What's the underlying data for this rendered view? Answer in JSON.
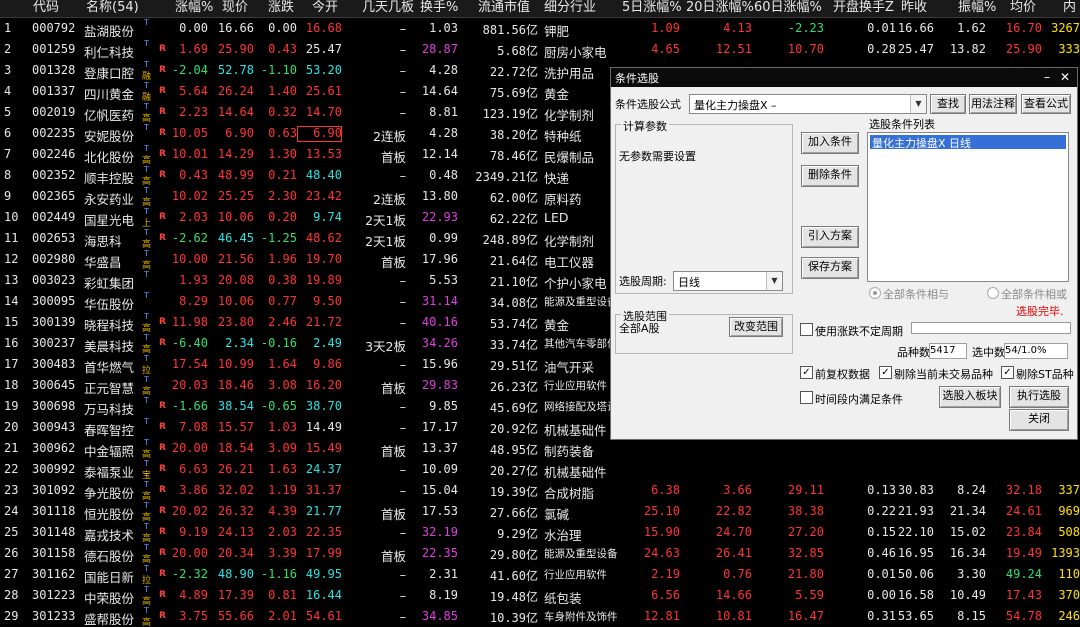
{
  "headers": [
    "代码",
    "名称(54)",
    "涨幅%",
    "现价",
    "涨跌",
    "今开",
    "几天几板",
    "换手%",
    "流通市值",
    "细分行业",
    "5日涨幅%",
    "20日涨幅%",
    "60日涨幅%",
    "开盘换手Z",
    "昨收",
    "振幅%",
    "均价",
    "内"
  ],
  "rows": [
    {
      "n": "1",
      "code": "000792",
      "name": "盐湖股份",
      "mk": "T",
      "flag": "",
      "chg": "0.00",
      "price": "16.66",
      "diff": "0.00",
      "open": "16.68",
      "consec": "–",
      "turn": "1.03",
      "cap": "881.56亿",
      "ind": "钾肥",
      "d5": "1.09",
      "d20": "4.13",
      "d60": "-2.23",
      "oturn": "0.01",
      "prev": "16.66",
      "amp": "1.62",
      "avg": "16.70",
      "inn": "3267",
      "tc": {
        "chg": "wht",
        "price": "wht",
        "diff": "wht",
        "open": "red",
        "d5": "red",
        "d20": "red",
        "d60": "grn",
        "avg": "red",
        "turn": "wht"
      }
    },
    {
      "n": "2",
      "code": "001259",
      "name": "利仁科技",
      "mk": "T",
      "flag": "R",
      "chg": "1.69",
      "price": "25.90",
      "diff": "0.43",
      "open": "25.47",
      "consec": "–",
      "turn": "28.87",
      "cap": "5.68亿",
      "ind": "厨房小家电",
      "d5": "4.65",
      "d20": "12.51",
      "d60": "10.70",
      "oturn": "0.28",
      "prev": "25.47",
      "amp": "13.82",
      "avg": "25.90",
      "inn": "333",
      "tc": {
        "chg": "red",
        "price": "red",
        "diff": "red",
        "open": "wht",
        "d5": "red",
        "d20": "red",
        "d60": "red",
        "avg": "red",
        "turn": "mag"
      }
    },
    {
      "n": "3",
      "code": "001328",
      "name": "登康口腔",
      "mk": "T",
      "mk2": "融",
      "flag": "R",
      "chg": "-2.04",
      "price": "52.78",
      "diff": "-1.10",
      "open": "53.20",
      "consec": "–",
      "turn": "4.28",
      "cap": "22.72亿",
      "ind": "洗护用品",
      "d5": "",
      "d20": "",
      "d60": "",
      "oturn": "",
      "prev": "",
      "amp": "",
      "avg": "",
      "inn": "",
      "tc": {
        "chg": "grn",
        "price": "cyan",
        "diff": "grn",
        "open": "cyan",
        "turn": "wht"
      }
    },
    {
      "n": "4",
      "code": "001337",
      "name": "四川黄金",
      "mk": "T",
      "mk2": "融",
      "flag": "R",
      "chg": "5.64",
      "price": "26.24",
      "diff": "1.40",
      "open": "25.61",
      "consec": "–",
      "turn": "14.64",
      "cap": "75.69亿",
      "ind": "黄金",
      "d5": "",
      "d20": "",
      "d60": "",
      "oturn": "",
      "prev": "",
      "amp": "",
      "avg": "",
      "inn": "",
      "tc": {
        "chg": "red",
        "price": "red",
        "diff": "red",
        "open": "red",
        "turn": "wht"
      }
    },
    {
      "n": "5",
      "code": "002019",
      "name": "亿帆医药",
      "mk": "T",
      "mk2": "高",
      "flag": "R",
      "chg": "2.23",
      "price": "14.64",
      "diff": "0.32",
      "open": "14.70",
      "consec": "–",
      "turn": "8.81",
      "cap": "123.19亿",
      "ind": "化学制剂",
      "d5": "",
      "d20": "",
      "d60": "",
      "oturn": "",
      "prev": "",
      "amp": "",
      "avg": "",
      "inn": "",
      "tc": {
        "chg": "red",
        "price": "red",
        "diff": "red",
        "open": "red",
        "turn": "wht"
      }
    },
    {
      "n": "6",
      "code": "002235",
      "name": "安妮股份",
      "mk": "T",
      "flag": "R",
      "chg": "10.05",
      "price": "6.90",
      "diff": "0.63",
      "open": "6.90",
      "consec": "2连板",
      "turn": "4.28",
      "cap": "38.20亿",
      "ind": "特种纸",
      "d5": "",
      "d20": "",
      "d60": "",
      "oturn": "",
      "prev": "",
      "amp": "",
      "avg": "",
      "inn": "",
      "box": true,
      "tc": {
        "chg": "red",
        "price": "red",
        "diff": "red",
        "open": "red",
        "turn": "wht"
      }
    },
    {
      "n": "7",
      "code": "002246",
      "name": "北化股份",
      "mk": "T",
      "mk2": "高",
      "flag": "R",
      "chg": "10.01",
      "price": "14.29",
      "diff": "1.30",
      "open": "13.53",
      "consec": "首板",
      "turn": "12.14",
      "cap": "78.46亿",
      "ind": "民爆制品",
      "d5": "",
      "d20": "",
      "d60": "",
      "oturn": "",
      "prev": "",
      "amp": "",
      "avg": "",
      "inn": "",
      "tc": {
        "chg": "red",
        "price": "red",
        "diff": "red",
        "open": "red",
        "turn": "wht"
      }
    },
    {
      "n": "8",
      "code": "002352",
      "name": "顺丰控股",
      "mk": "T",
      "mk2": "高",
      "flag": "R",
      "chg": "0.43",
      "price": "48.99",
      "diff": "0.21",
      "open": "48.40",
      "consec": "–",
      "turn": "0.48",
      "cap": "2349.21亿",
      "ind": "快递",
      "d5": "",
      "d20": "",
      "d60": "",
      "oturn": "",
      "prev": "",
      "amp": "",
      "avg": "",
      "inn": "",
      "tc": {
        "chg": "red",
        "price": "red",
        "diff": "red",
        "open": "cyan",
        "turn": "wht"
      }
    },
    {
      "n": "9",
      "code": "002365",
      "name": "永安药业",
      "mk": "T",
      "mk2": "高",
      "flag": "",
      "chg": "10.02",
      "price": "25.25",
      "diff": "2.30",
      "open": "23.42",
      "consec": "2连板",
      "turn": "13.80",
      "cap": "62.00亿",
      "ind": "原料药",
      "d5": "",
      "d20": "",
      "d60": "",
      "oturn": "",
      "prev": "",
      "amp": "",
      "avg": "",
      "inn": "",
      "tc": {
        "chg": "red",
        "price": "red",
        "diff": "red",
        "open": "red",
        "turn": "wht"
      }
    },
    {
      "n": "10",
      "code": "002449",
      "name": "国星光电",
      "mk": "T",
      "mk2": "上",
      "flag": "R",
      "chg": "2.03",
      "price": "10.06",
      "diff": "0.20",
      "open": "9.74",
      "consec": "2天1板",
      "turn": "22.93",
      "cap": "62.22亿",
      "ind": "LED",
      "d5": "",
      "d20": "",
      "d60": "",
      "oturn": "",
      "prev": "",
      "amp": "",
      "avg": "",
      "inn": "",
      "tc": {
        "chg": "red",
        "price": "red",
        "diff": "red",
        "open": "cyan",
        "turn": "mag"
      }
    },
    {
      "n": "11",
      "code": "002653",
      "name": "海思科",
      "mk": "T",
      "mk2": "高",
      "flag": "R",
      "chg": "-2.62",
      "price": "46.45",
      "diff": "-1.25",
      "open": "48.62",
      "consec": "2天1板",
      "turn": "0.99",
      "cap": "248.89亿",
      "ind": "化学制剂",
      "d5": "",
      "d20": "",
      "d60": "",
      "oturn": "",
      "prev": "",
      "amp": "",
      "avg": "",
      "inn": "",
      "tc": {
        "chg": "grn",
        "price": "cyan",
        "diff": "grn",
        "open": "red",
        "turn": "wht"
      }
    },
    {
      "n": "12",
      "code": "002980",
      "name": "华盛昌",
      "mk": "T",
      "mk2": "高",
      "flag": "",
      "chg": "10.00",
      "price": "21.56",
      "diff": "1.96",
      "open": "19.70",
      "consec": "首板",
      "turn": "17.96",
      "cap": "21.64亿",
      "ind": "电工仪器",
      "d5": "",
      "d20": "",
      "d60": "",
      "oturn": "",
      "prev": "",
      "amp": "",
      "avg": "",
      "inn": "",
      "tc": {
        "chg": "red",
        "price": "red",
        "diff": "red",
        "open": "red",
        "turn": "wht"
      }
    },
    {
      "n": "13",
      "code": "003023",
      "name": "彩虹集团",
      "mk": "T",
      "flag": "",
      "chg": "1.93",
      "price": "20.08",
      "diff": "0.38",
      "open": "19.89",
      "consec": "–",
      "turn": "5.53",
      "cap": "21.10亿",
      "ind": "个护小家电",
      "d5": "",
      "d20": "",
      "d60": "",
      "oturn": "",
      "prev": "",
      "amp": "",
      "avg": "",
      "inn": "",
      "tc": {
        "chg": "red",
        "price": "red",
        "diff": "red",
        "open": "red",
        "turn": "wht"
      }
    },
    {
      "n": "14",
      "code": "300095",
      "name": "华伍股份",
      "mk": "T",
      "flag": "",
      "chg": "8.29",
      "price": "10.06",
      "diff": "0.77",
      "open": "9.50",
      "consec": "–",
      "turn": "31.14",
      "cap": "34.08亿",
      "ind": "能源及重型设备",
      "sm": true,
      "d5": "",
      "d20": "",
      "d60": "",
      "oturn": "",
      "prev": "",
      "amp": "",
      "avg": "",
      "inn": "",
      "tc": {
        "chg": "red",
        "price": "red",
        "diff": "red",
        "open": "red",
        "turn": "mag"
      }
    },
    {
      "n": "15",
      "code": "300139",
      "name": "晓程科技",
      "mk": "T",
      "mk2": "高",
      "flag": "R",
      "chg": "11.98",
      "price": "23.80",
      "diff": "2.46",
      "open": "21.72",
      "consec": "–",
      "turn": "40.16",
      "cap": "53.74亿",
      "ind": "黄金",
      "d5": "",
      "d20": "",
      "d60": "",
      "oturn": "",
      "prev": "",
      "amp": "",
      "avg": "",
      "inn": "",
      "tc": {
        "chg": "red",
        "price": "red",
        "diff": "red",
        "open": "red",
        "turn": "mag"
      }
    },
    {
      "n": "16",
      "code": "300237",
      "name": "美晨科技",
      "mk": "T",
      "mk2": "高",
      "flag": "R",
      "chg": "-6.40",
      "price": "2.34",
      "diff": "-0.16",
      "open": "2.49",
      "consec": "3天2板",
      "turn": "34.26",
      "cap": "33.74亿",
      "ind": "其他汽车零部件",
      "sm": true,
      "d5": "",
      "d20": "",
      "d60": "",
      "oturn": "",
      "prev": "",
      "amp": "",
      "avg": "",
      "inn": "",
      "tc": {
        "chg": "grn",
        "price": "cyan",
        "diff": "grn",
        "open": "cyan",
        "turn": "mag"
      }
    },
    {
      "n": "17",
      "code": "300483",
      "name": "首华燃气",
      "mk": "T",
      "mk2": "拉",
      "flag": "",
      "chg": "17.54",
      "price": "10.99",
      "diff": "1.64",
      "open": "9.86",
      "consec": "–",
      "turn": "15.96",
      "cap": "29.51亿",
      "ind": "油气开采",
      "d5": "",
      "d20": "",
      "d60": "",
      "oturn": "",
      "prev": "",
      "amp": "",
      "avg": "",
      "inn": "",
      "tc": {
        "chg": "red",
        "price": "red",
        "diff": "red",
        "open": "red",
        "turn": "wht"
      }
    },
    {
      "n": "18",
      "code": "300645",
      "name": "正元智慧",
      "mk": "T",
      "mk2": "高",
      "flag": "",
      "chg": "20.03",
      "price": "18.46",
      "diff": "3.08",
      "open": "16.20",
      "consec": "首板",
      "turn": "29.83",
      "cap": "26.23亿",
      "ind": "行业应用软件",
      "sm": true,
      "d5": "",
      "d20": "",
      "d60": "",
      "oturn": "",
      "prev": "",
      "amp": "",
      "avg": "",
      "inn": "",
      "tc": {
        "chg": "red",
        "price": "red",
        "diff": "red",
        "open": "red",
        "turn": "mag"
      }
    },
    {
      "n": "19",
      "code": "300698",
      "name": "万马科技",
      "mk": "T",
      "flag": "R",
      "chg": "-1.66",
      "price": "38.54",
      "diff": "-0.65",
      "open": "38.70",
      "consec": "–",
      "turn": "9.85",
      "cap": "45.69亿",
      "ind": "网络接配及塔设",
      "sm": true,
      "d5": "",
      "d20": "",
      "d60": "",
      "oturn": "",
      "prev": "",
      "amp": "",
      "avg": "",
      "inn": "",
      "tc": {
        "chg": "grn",
        "price": "cyan",
        "diff": "grn",
        "open": "cyan",
        "turn": "wht"
      }
    },
    {
      "n": "20",
      "code": "300943",
      "name": "春晖智控",
      "mk": "T",
      "flag": "R",
      "chg": "7.08",
      "price": "15.57",
      "diff": "1.03",
      "open": "14.49",
      "consec": "–",
      "turn": "17.17",
      "cap": "20.92亿",
      "ind": "机械基础件",
      "d5": "",
      "d20": "",
      "d60": "",
      "oturn": "",
      "prev": "",
      "amp": "",
      "avg": "",
      "inn": "",
      "tc": {
        "chg": "red",
        "price": "red",
        "diff": "red",
        "open": "wht",
        "turn": "wht"
      }
    },
    {
      "n": "21",
      "code": "300962",
      "name": "中金辐照",
      "mk": "T",
      "mk2": "高",
      "flag": "R",
      "chg": "20.00",
      "price": "18.54",
      "diff": "3.09",
      "open": "15.49",
      "consec": "首板",
      "turn": "13.37",
      "cap": "48.95亿",
      "ind": "制药装备",
      "d5": "",
      "d20": "",
      "d60": "",
      "oturn": "",
      "prev": "",
      "amp": "",
      "avg": "",
      "inn": "",
      "tc": {
        "chg": "red",
        "price": "red",
        "diff": "red",
        "open": "red",
        "turn": "wht"
      }
    },
    {
      "n": "22",
      "code": "300992",
      "name": "泰福泵业",
      "mk": "T",
      "mk2": "宝",
      "flag": "R",
      "chg": "6.63",
      "price": "26.21",
      "diff": "1.63",
      "open": "24.37",
      "consec": "–",
      "turn": "10.09",
      "cap": "20.27亿",
      "ind": "机械基础件",
      "d5": "",
      "d20": "",
      "d60": "",
      "oturn": "",
      "prev": "",
      "amp": "",
      "avg": "",
      "inn": "",
      "tc": {
        "chg": "red",
        "price": "red",
        "diff": "red",
        "open": "cyan",
        "turn": "wht"
      }
    },
    {
      "n": "23",
      "code": "301092",
      "name": "争光股份",
      "mk": "T",
      "mk2": "高",
      "flag": "R",
      "chg": "3.86",
      "price": "32.02",
      "diff": "1.19",
      "open": "31.37",
      "consec": "–",
      "turn": "15.04",
      "cap": "19.39亿",
      "ind": "合成树脂",
      "d5": "6.38",
      "d20": "3.66",
      "d60": "29.11",
      "oturn": "0.13",
      "prev": "30.83",
      "amp": "8.24",
      "avg": "32.18",
      "inn": "337",
      "tc": {
        "chg": "red",
        "price": "red",
        "diff": "red",
        "open": "red",
        "d5": "red",
        "d20": "red",
        "d60": "red",
        "avg": "red",
        "turn": "wht"
      }
    },
    {
      "n": "24",
      "code": "301118",
      "name": "恒光股份",
      "mk": "T",
      "mk2": "高",
      "flag": "R",
      "chg": "20.02",
      "price": "26.32",
      "diff": "4.39",
      "open": "21.77",
      "consec": "首板",
      "turn": "17.53",
      "cap": "27.66亿",
      "ind": "氯碱",
      "d5": "25.10",
      "d20": "22.82",
      "d60": "38.38",
      "oturn": "0.22",
      "prev": "21.93",
      "amp": "21.34",
      "avg": "24.61",
      "inn": "969",
      "tc": {
        "chg": "red",
        "price": "red",
        "diff": "red",
        "open": "cyan",
        "d5": "red",
        "d20": "red",
        "d60": "red",
        "avg": "red",
        "turn": "wht"
      }
    },
    {
      "n": "25",
      "code": "301148",
      "name": "嘉戎技术",
      "mk": "T",
      "mk2": "高",
      "flag": "R",
      "chg": "9.19",
      "price": "24.13",
      "diff": "2.03",
      "open": "22.35",
      "consec": "–",
      "turn": "32.19",
      "cap": "9.29亿",
      "ind": "水治理",
      "d5": "15.90",
      "d20": "24.70",
      "d60": "27.20",
      "oturn": "0.15",
      "prev": "22.10",
      "amp": "15.02",
      "avg": "23.84",
      "inn": "508",
      "tc": {
        "chg": "red",
        "price": "red",
        "diff": "red",
        "open": "red",
        "d5": "red",
        "d20": "red",
        "d60": "red",
        "avg": "red",
        "turn": "mag"
      }
    },
    {
      "n": "26",
      "code": "301158",
      "name": "德石股份",
      "mk": "T",
      "mk2": "高",
      "flag": "R",
      "chg": "20.00",
      "price": "20.34",
      "diff": "3.39",
      "open": "17.99",
      "consec": "首板",
      "turn": "22.35",
      "cap": "29.80亿",
      "ind": "能源及重型设备",
      "sm": true,
      "d5": "24.63",
      "d20": "26.41",
      "d60": "32.85",
      "oturn": "0.46",
      "prev": "16.95",
      "amp": "16.34",
      "avg": "19.49",
      "inn": "1393",
      "tc": {
        "chg": "red",
        "price": "red",
        "diff": "red",
        "open": "red",
        "d5": "red",
        "d20": "red",
        "d60": "red",
        "avg": "red",
        "turn": "mag"
      }
    },
    {
      "n": "27",
      "code": "301162",
      "name": "国能日新",
      "mk": "T",
      "mk2": "拉",
      "flag": "R",
      "chg": "-2.32",
      "price": "48.90",
      "diff": "-1.16",
      "open": "49.95",
      "consec": "–",
      "turn": "2.31",
      "cap": "41.60亿",
      "ind": "行业应用软件",
      "sm": true,
      "d5": "2.19",
      "d20": "0.76",
      "d60": "21.80",
      "oturn": "0.01",
      "prev": "50.06",
      "amp": "3.30",
      "avg": "49.24",
      "inn": "110",
      "tc": {
        "chg": "grn",
        "price": "cyan",
        "diff": "grn",
        "open": "cyan",
        "d5": "red",
        "d20": "red",
        "d60": "red",
        "avg": "grn",
        "turn": "wht"
      }
    },
    {
      "n": "28",
      "code": "301223",
      "name": "中荣股份",
      "mk": "T",
      "mk2": "高",
      "flag": "R",
      "chg": "4.89",
      "price": "17.39",
      "diff": "0.81",
      "open": "16.44",
      "consec": "–",
      "turn": "8.19",
      "cap": "19.48亿",
      "ind": "纸包装",
      "d5": "6.56",
      "d20": "14.66",
      "d60": "5.59",
      "oturn": "0.00",
      "prev": "16.58",
      "amp": "10.49",
      "avg": "17.43",
      "inn": "370",
      "tc": {
        "chg": "red",
        "price": "red",
        "diff": "red",
        "open": "cyan",
        "d5": "red",
        "d20": "red",
        "d60": "red",
        "avg": "red",
        "turn": "wht"
      }
    },
    {
      "n": "29",
      "code": "301233",
      "name": "盛帮股份",
      "mk": "T",
      "mk2": "高",
      "flag": "R",
      "chg": "3.75",
      "price": "55.66",
      "diff": "2.01",
      "open": "54.61",
      "consec": "–",
      "turn": "34.85",
      "cap": "10.39亿",
      "ind": "车身附件及饰件",
      "sm": true,
      "d5": "12.81",
      "d20": "10.81",
      "d60": "16.47",
      "oturn": "0.31",
      "prev": "53.65",
      "amp": "8.15",
      "avg": "54.78",
      "inn": "246",
      "tc": {
        "chg": "red",
        "price": "red",
        "diff": "red",
        "open": "red",
        "d5": "red",
        "d20": "red",
        "d60": "red",
        "avg": "red",
        "turn": "mag"
      }
    }
  ],
  "dialog": {
    "title": "条件选股",
    "formula_label": "条件选股公式",
    "formula_value": "量化主力操盘X  –",
    "btn_search": "查找",
    "btn_usage": "用法注释",
    "btn_view": "查看公式",
    "calc_group": "计算参数",
    "no_params": "无参数需要设置",
    "btn_add": "加入条件",
    "btn_delete": "删除条件",
    "btn_import": "引入方案",
    "btn_save": "保存方案",
    "list_title": "选股条件列表",
    "list_item": "量化主力操盘X   日线",
    "period_label": "选股周期:",
    "period_value": "日线",
    "radio_and": "全部条件相与",
    "radio_or": "全部条件相或",
    "done": "选股完毕.",
    "range_group": "选股范围",
    "range_value": "全部A股",
    "btn_change_range": "改变范围",
    "chk_unfixed": "使用涨跌不定周期",
    "count_label": "品种数",
    "count_value": "5417",
    "selected_label": "选中数",
    "selected_value": "54/1.0%",
    "chk_prefq": "前复权数据",
    "chk_exclude_halt": "剔除当前未交易品种",
    "chk_exclude_st": "剔除ST品种",
    "chk_timerange": "时间段内满足条件",
    "btn_to_block": "选股入板块",
    "btn_run": "执行选股",
    "btn_close": "关闭"
  }
}
